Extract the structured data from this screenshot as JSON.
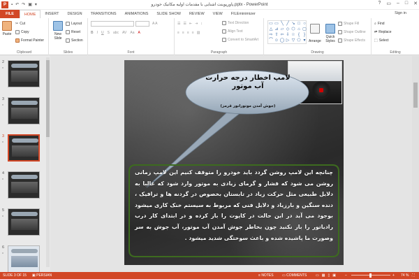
{
  "titlebar": {
    "logo": "P",
    "title": "پاورپوینت آشنایی با مقدمات اولیه مکانیک خودرو.pptx - PowerPoint",
    "minimize": "–",
    "maximize": "□",
    "close": "✕"
  },
  "tabs": [
    "FILE",
    "HOME",
    "INSERT",
    "DESIGN",
    "TRANSITIONS",
    "ANIMATIONS",
    "SLIDE SHOW",
    "REVIEW",
    "VIEW",
    "FILEminimizer"
  ],
  "active_tab": "HOME",
  "signin": "Sign in",
  "ribbon": {
    "clipboard": {
      "paste": "Paste",
      "cut": "Cut",
      "copy": "Copy",
      "format_painter": "Format Painter",
      "label": "Clipboard"
    },
    "slides": {
      "new_slide": "New Slide",
      "layout": "Layout",
      "reset": "Reset",
      "section": "Section",
      "label": "Slides"
    },
    "font": {
      "label": "Font"
    },
    "paragraph": {
      "text_direction": "Text Direction",
      "align_text": "Align Text",
      "convert_smartart": "Convert to SmartArt",
      "label": "Paragraph"
    },
    "drawing": {
      "arrange": "Arrange",
      "quick_styles": "Quick Styles",
      "shape_fill": "Shape Fill",
      "shape_outline": "Shape Outline",
      "shape_effects": "Shape Effects",
      "label": "Drawing"
    },
    "editing": {
      "find": "Find",
      "replace": "Replace",
      "select": "Select",
      "label": "Editing"
    }
  },
  "slides_panel": [
    {
      "num": "2",
      "star": "*"
    },
    {
      "num": "3",
      "star": "*"
    },
    {
      "num": "3",
      "star": "*"
    },
    {
      "num": "4",
      "star": "*"
    },
    {
      "num": "5",
      "star": "*"
    },
    {
      "num": "6",
      "star": "*"
    }
  ],
  "slide": {
    "callout_title": "لامپ اخطار درجه حرارت آب موتور",
    "callout_subtitle": "(جوش آمدن موتورانور قرمز)",
    "body": "چنانچه این لامپ روشن گردد باید خودرو را متوقف کنیم این لامپ زمانی روشن می شود که فشار و گرمای زیادی به موتور وارد شود که غالبا به دلایل طبیعی مثل حرکت زیاد در تابستان بخصوص در گردنه ها و ترافیک ، دنده سنگین و بارزیاد و دلایل فنی که مربوط به سیستم خنک کاری میشود بوجود می آید در این حالت در کاپوت را باز کرده و در ابتدای کار درب رادیاتور را باز نکنید چون بخاطر جوش آمدن آب موتور، آب جوش به سر وصورت ما پاشیده شده و باعث سوختگی شدید میشود ."
  },
  "statusbar": {
    "slide_counter": "SLIDE 3 OF 15",
    "language": "PERSIAN",
    "notes": "NOTES",
    "comments": "COMMENTS",
    "zoom": "74 %"
  }
}
